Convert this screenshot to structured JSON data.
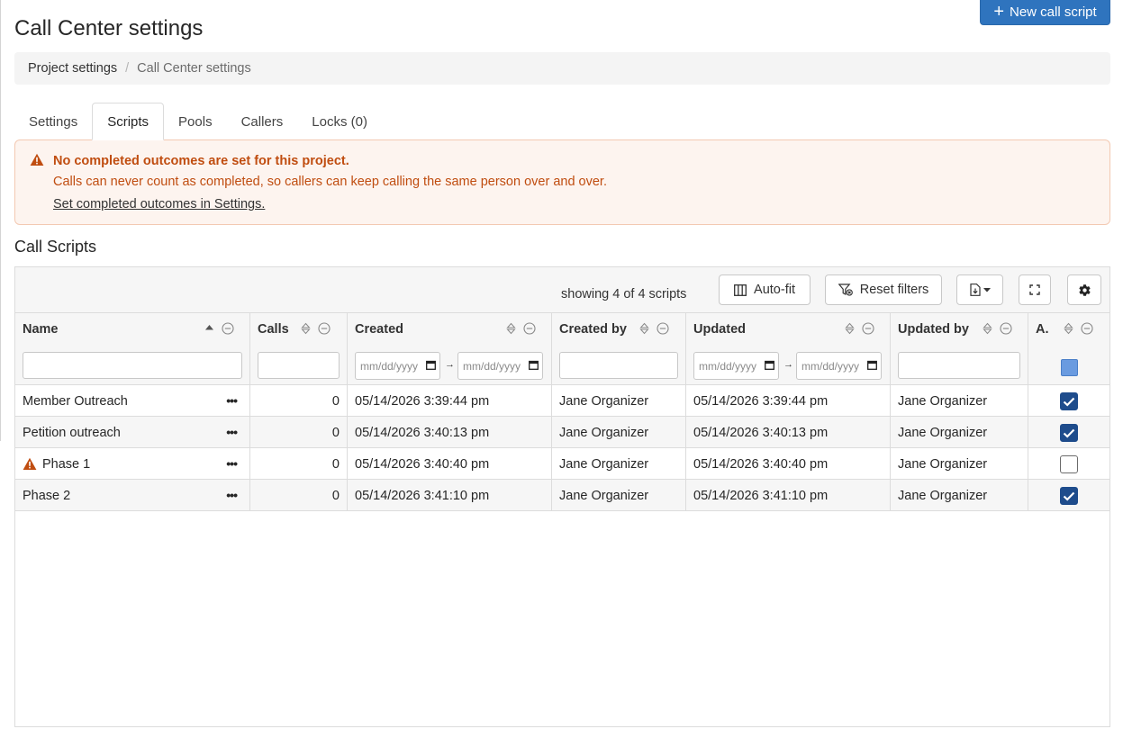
{
  "page": {
    "title": "Call Center settings"
  },
  "header": {
    "new_script_label": "New call script"
  },
  "breadcrumb": {
    "parent": "Project settings",
    "separator": "/",
    "current": "Call Center settings"
  },
  "tabs": [
    {
      "label": "Settings"
    },
    {
      "label": "Scripts",
      "active": true
    },
    {
      "label": "Pools"
    },
    {
      "label": "Callers"
    },
    {
      "label": "Locks (0)"
    }
  ],
  "alert": {
    "title": "No completed outcomes are set for this project.",
    "body": "Calls can never count as completed, so callers can keep calling the same person over and over.",
    "link": "Set completed outcomes in Settings.",
    "icon": "warning-triangle-icon",
    "color": "#c04d10"
  },
  "section": {
    "title": "Call Scripts"
  },
  "toolbar": {
    "showing": "showing 4 of 4 scripts",
    "autofit_label": "Auto-fit",
    "reset_label": "Reset filters"
  },
  "columns": [
    {
      "label": "Name"
    },
    {
      "label": "Calls"
    },
    {
      "label": "Created"
    },
    {
      "label": "Created by"
    },
    {
      "label": "Updated"
    },
    {
      "label": "Updated by"
    },
    {
      "label": "A."
    }
  ],
  "date_placeholder": "mm/dd/yyyy",
  "date_arrow": "→",
  "row_menu": "•••",
  "rows": [
    {
      "name": "Member Outreach",
      "calls": "0",
      "created": "05/14/2026 3:39:44 pm",
      "created_by": "Jane Organizer",
      "updated": "05/14/2026 3:39:44 pm",
      "updated_by": "Jane Organizer",
      "active": true,
      "warning": false
    },
    {
      "name": "Petition outreach",
      "calls": "0",
      "created": "05/14/2026 3:40:13 pm",
      "created_by": "Jane Organizer",
      "updated": "05/14/2026 3:40:13 pm",
      "updated_by": "Jane Organizer",
      "active": true,
      "warning": false
    },
    {
      "name": "Phase 1",
      "calls": "0",
      "created": "05/14/2026 3:40:40 pm",
      "created_by": "Jane Organizer",
      "updated": "05/14/2026 3:40:40 pm",
      "updated_by": "Jane Organizer",
      "active": false,
      "warning": true
    },
    {
      "name": "Phase 2",
      "calls": "0",
      "created": "05/14/2026 3:41:10 pm",
      "created_by": "Jane Organizer",
      "updated": "05/14/2026 3:41:10 pm",
      "updated_by": "Jane Organizer",
      "active": true,
      "warning": false
    }
  ],
  "colors": {
    "primary": "#2f74be",
    "warning": "#c04d10",
    "checkbox": "#1e4c8c"
  }
}
